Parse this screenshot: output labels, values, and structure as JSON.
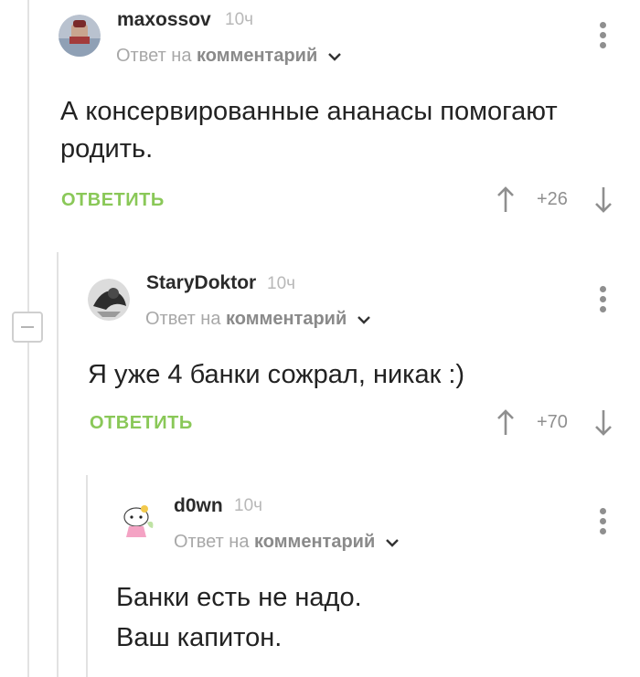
{
  "comments": [
    {
      "username": "maxossov",
      "time": "10ч",
      "reply_prefix": "Ответ на",
      "reply_target": "комментарий",
      "text": "А консервированные ананасы помогают родить.",
      "reply_label": "ОТВЕТИТЬ",
      "rating": "+26"
    },
    {
      "username": "StaryDoktor",
      "time": "10ч",
      "reply_prefix": "Ответ на",
      "reply_target": "комментарий",
      "text": "Я уже 4 банки сожрал, никак :)",
      "reply_label": "ОТВЕТИТЬ",
      "rating": "+70"
    },
    {
      "username": "d0wn",
      "time": "10ч",
      "reply_prefix": "Ответ на",
      "reply_target": "комментарий",
      "text_line1": "Банки есть не надо.",
      "text_line2": "Ваш капитон."
    }
  ],
  "colors": {
    "accent_green": "#8ac858",
    "muted": "#a8a8a8",
    "thread_line": "#e2e2e2"
  },
  "icons": [
    "avatar",
    "chevron-down-icon",
    "more-vertical-icon",
    "arrow-up-icon",
    "arrow-down-icon",
    "collapse-icon"
  ]
}
